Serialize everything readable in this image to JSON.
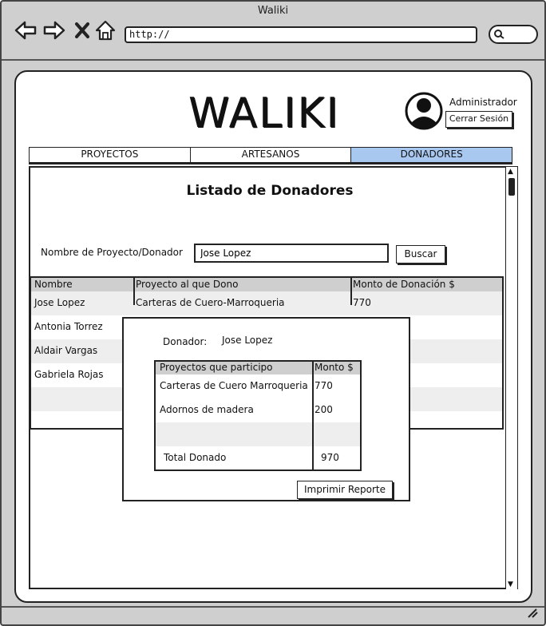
{
  "window": {
    "title": "Waliki"
  },
  "browser": {
    "address": "http://",
    "nav_icons": [
      "back-arrow-icon",
      "forward-arrow-icon",
      "close-x-icon",
      "home-icon"
    ]
  },
  "header": {
    "logo": "WALIKI",
    "user": {
      "name": "Administrador",
      "logout_label": "Cerrar Sesión"
    }
  },
  "tabs": [
    {
      "label": "PROYECTOS",
      "active": false
    },
    {
      "label": "ARTESANOS",
      "active": false
    },
    {
      "label": "DONADORES",
      "active": true
    }
  ],
  "main": {
    "title": "Listado de Donadores",
    "search": {
      "label": "Nombre de Proyecto/Donador",
      "value": "Jose Lopez",
      "button": "Buscar"
    },
    "table": {
      "headers": [
        "Nombre",
        "Proyecto al que Dono",
        "Monto de Donación $"
      ],
      "rows": [
        [
          "Jose Lopez",
          "Carteras de Cuero-Marroqueria",
          "770"
        ],
        [
          "Antonia Torrez",
          "",
          ""
        ],
        [
          "Aldair Vargas",
          "",
          ""
        ],
        [
          "Gabriela Rojas",
          "",
          ""
        ],
        [
          "",
          "",
          ""
        ]
      ]
    }
  },
  "modal": {
    "donor_label": "Donador:",
    "donor_name": "Jose Lopez",
    "table": {
      "headers": [
        "Proyectos que participo",
        "Monto $"
      ],
      "rows": [
        [
          "Carteras de Cuero Marroqueria",
          "770"
        ],
        [
          "Adornos de madera",
          "200"
        ],
        [
          "",
          ""
        ]
      ],
      "total_label": "Total Donado",
      "total_value": "970"
    },
    "print_button": "Imprimir Reporte"
  }
}
